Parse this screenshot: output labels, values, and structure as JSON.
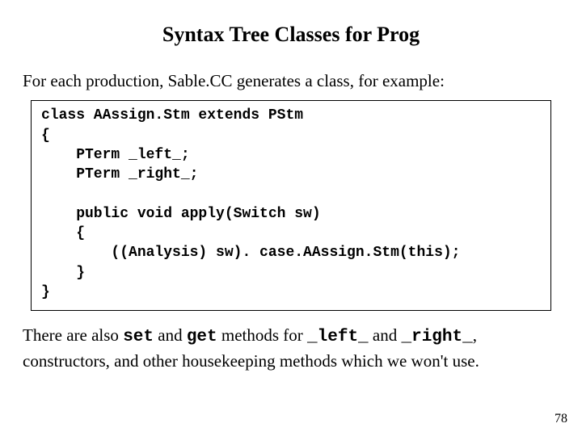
{
  "title": "Syntax Tree Classes for Prog",
  "intro": "For each production, Sable.CC generates a class, for example:",
  "code": "class AAssign.Stm extends PStm\n{\n    PTerm _left_;\n    PTerm _right_;\n\n    public void apply(Switch sw)\n    {\n        ((Analysis) sw). case.AAssign.Stm(this);\n    }\n}",
  "footer": {
    "t1": "There are also ",
    "c1": "set",
    "t2": " and ",
    "c2": "get",
    "t3": " methods for ",
    "c3": "_left_",
    "t4": " and ",
    "c4": "_right_",
    "t5": ", constructors, and other housekeeping methods which we won't use."
  },
  "page_number": "78"
}
